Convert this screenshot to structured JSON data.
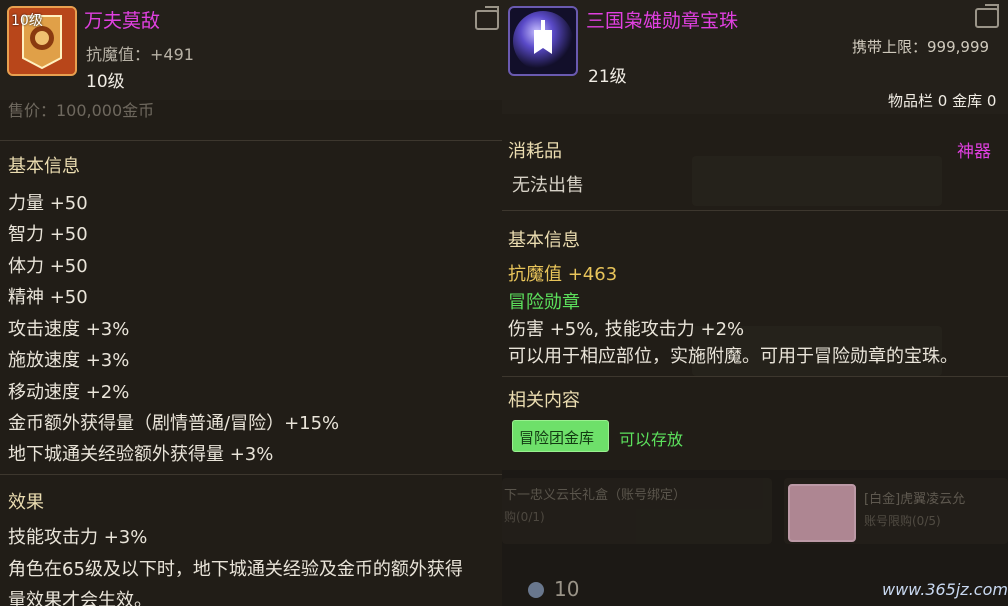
{
  "left": {
    "item_icon_text": "10级",
    "title": "万夫莫敌",
    "magic_resist": "抗魔值：+491",
    "level": "10级",
    "price_faded": "售价：100,000金币",
    "section_basic": "基本信息",
    "stats": [
      "力量 +50",
      "智力 +50",
      "体力 +50",
      "精神 +50",
      "攻击速度 +3%",
      "施放速度 +3%",
      "移动速度 +2%",
      "金币额外获得量（剧情普通/冒险）+15%",
      "地下城通关经验额外获得量 +3%"
    ],
    "section_effect": "效果",
    "effects": [
      "技能攻击力 +3%",
      "角色在65级及以下时，地下城通关经验及金币的额外获得",
      "量效果才会生效。"
    ]
  },
  "right": {
    "title": "三国枭雄勋章宝珠",
    "carry_limit": "携带上限：999,999",
    "level": "21级",
    "inventory": "物品栏 0 金库 0",
    "category": "消耗品",
    "rarity": "神器",
    "cannot_sell": "无法出售",
    "section_basic": "基本信息",
    "magic_resist": "抗魔值 +463",
    "medal_label": "冒险勋章",
    "medal_desc_1": "伤害 +5%, 技能攻击力 +2%",
    "medal_desc_2": "可以用于相应部位，实施附魔。可用于冒险勋章的宝珠。",
    "section_related": "相关内容",
    "vault_button": "冒险团金库",
    "can_store": "可以存放",
    "bg_item_1": "下一忠义云长礼盒（账号绑定）",
    "bg_item_1_sub": "购(0/1)",
    "bg_item_2": "[白金]虎翼凌云允",
    "bg_item_2_sub": "账号限购(0/5)",
    "bg_currency": "10",
    "watermark": "www.365jz.com"
  },
  "colors": {
    "title_magenta": "#e040e0",
    "gold": "#e8c45a",
    "green": "#5ce05c",
    "section": "#eadcb0"
  }
}
